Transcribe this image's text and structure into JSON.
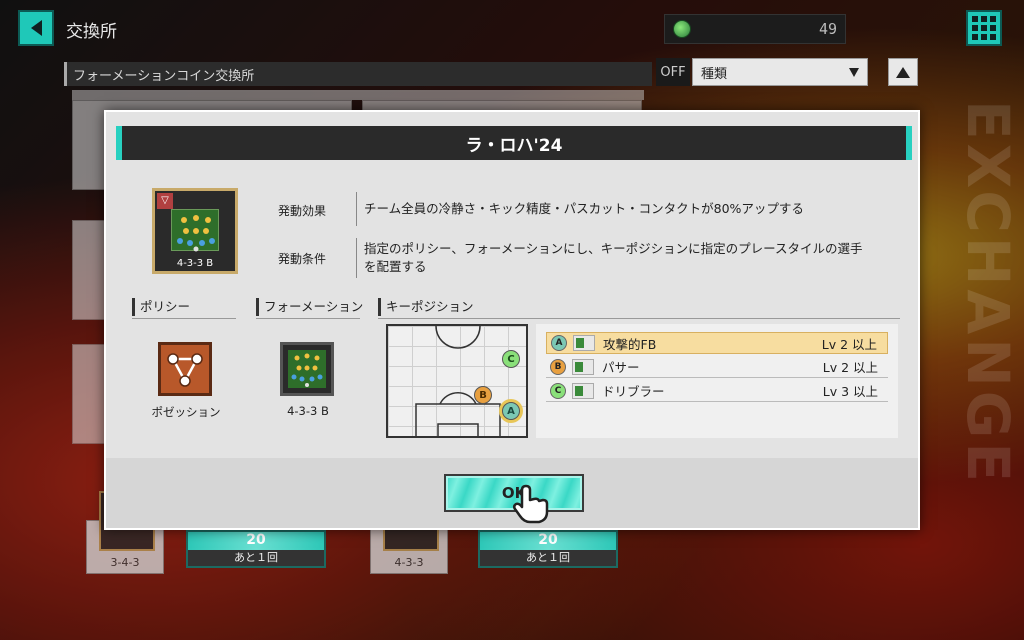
{
  "header": {
    "screen_title": "交換所",
    "coin_count": "49"
  },
  "toolbar": {
    "section_title": "フォーメーションコイン交換所",
    "filter_state": "OFF",
    "sort_label": "種類"
  },
  "background_cards": [
    {
      "formation": "3-4-3",
      "cost": "20",
      "remaining": "あと１回"
    },
    {
      "formation": "4-3-3",
      "cost": "20",
      "remaining": "あと１回"
    }
  ],
  "side_decoration": "EXCHANGE",
  "modal": {
    "title": "ラ・ロハ'24",
    "thumb_label": "4-3-3 B",
    "effect_label": "発動効果",
    "effect_text": "チーム全員の冷静さ・キック精度・パスカット・コンタクトが80%アップする",
    "condition_label": "発動条件",
    "condition_text": "指定のポリシー、フォーメーションにし、キーポジションに指定のプレースタイルの選手を配置する",
    "policy_heading": "ポリシー",
    "policy_value": "ポゼッション",
    "formation_heading": "フォーメーション",
    "formation_value": "4-3-3 B",
    "keypos_heading": "キーポジション",
    "positions": [
      {
        "marker": "A",
        "style": "攻撃的FB",
        "level": "Lv 2 以上",
        "selected": true
      },
      {
        "marker": "B",
        "style": "パサー",
        "level": "Lv 2 以上",
        "selected": false
      },
      {
        "marker": "C",
        "style": "ドリブラー",
        "level": "Lv 3 以上",
        "selected": false
      }
    ],
    "ok_label": "OK"
  },
  "colors": {
    "accent_teal": "#28d0c0",
    "marker_a": "#7bc8b4",
    "marker_b": "#e8a040",
    "marker_c": "#8ae07a",
    "selected_row": "#f7dda0"
  }
}
